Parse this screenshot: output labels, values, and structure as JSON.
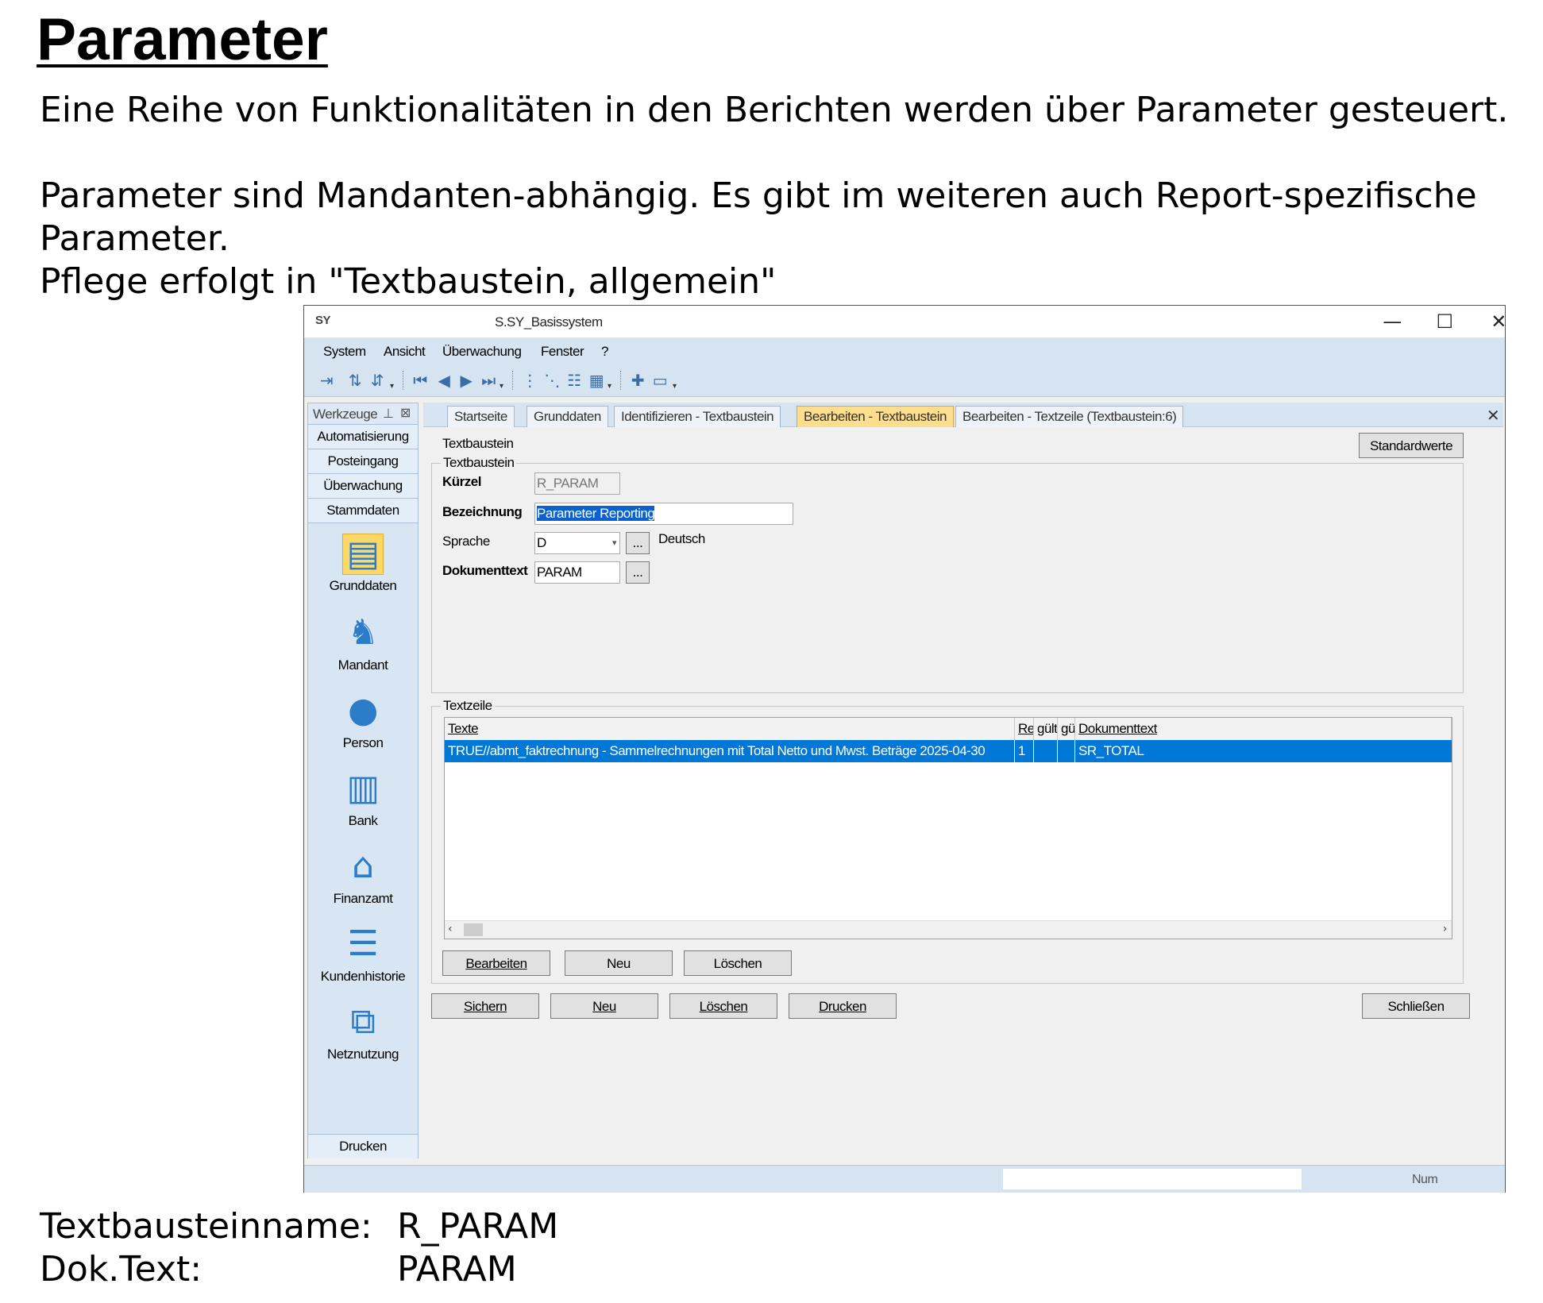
{
  "slide": {
    "title": "Parameter",
    "line1": "Eine Reihe von Funktionalitäten in den Berichten werden über Parameter gesteuert.",
    "line2": "Parameter sind Mandanten-abhängig. Es gibt im weiteren auch Report-spezifische",
    "line3": "Parameter.",
    "line4": "Pflege erfolgt in \"Textbaustein, allgemein\"",
    "footer_label1": "Textbausteinname:",
    "footer_value1": "R_PARAM",
    "footer_label2": "Dok.Text:",
    "footer_value2": "PARAM"
  },
  "window": {
    "logo": "SY",
    "title": "S.SY_Basissystem",
    "minimize": "—",
    "maximize": "☐",
    "close": "✕"
  },
  "menu": [
    "System",
    "Ansicht",
    "Überwachung",
    "Fenster",
    "?"
  ],
  "tools_panel": {
    "title": "Werkzeuge",
    "categories": [
      "Automatisierung",
      "Posteingang",
      "Überwachung",
      "Stammdaten"
    ],
    "items": [
      {
        "label": "Grunddaten",
        "icon": "grunddaten-icon"
      },
      {
        "label": "Mandant",
        "icon": "mandant-icon"
      },
      {
        "label": "Person",
        "icon": "person-icon"
      },
      {
        "label": "Bank",
        "icon": "bank-icon"
      },
      {
        "label": "Finanzamt",
        "icon": "finanzamt-icon"
      },
      {
        "label": "Kundenhistorie",
        "icon": "kundenhistorie-icon"
      },
      {
        "label": "Netznutzung",
        "icon": "netznutzung-icon"
      }
    ],
    "footer": "Drucken"
  },
  "tabs": [
    "Startseite",
    "Grunddaten",
    "Identifizieren - Textbaustein",
    "Bearbeiten - Textbaustein",
    "Bearbeiten - Textzeile (Textbaustein:6)"
  ],
  "active_tab": "Bearbeiten - Textbaustein",
  "form": {
    "heading": "Textbaustein",
    "standardwerte": "Standardwerte",
    "group_title": "Textbaustein",
    "kuerzel_label": "Kürzel",
    "kuerzel_value": "R_PARAM",
    "bezeichnung_label": "Bezeichnung",
    "bezeichnung_value": "Parameter Reporting",
    "sprache_label": "Sprache",
    "sprache_value": "D",
    "sprache_text": "Deutsch",
    "dokumenttext_label": "Dokumenttext",
    "dokumenttext_value": "PARAM",
    "ellipsis": "..."
  },
  "textzeile": {
    "group_title": "Textzeile",
    "columns": [
      "Texte",
      "Re",
      "gült",
      "gü",
      "Dokumenttext"
    ],
    "rows": [
      {
        "texte": "TRUE//abmt_faktrechnung - Sammelrechnungen mit Total Netto und Mwst. Beträge 2025-04-30",
        "re": "1",
        "guelt": "",
        "gue": "",
        "dokumenttext": "SR_TOTAL"
      }
    ],
    "buttons": [
      "Bearbeiten",
      "Neu",
      "Löschen"
    ]
  },
  "bottom_buttons": [
    "Sichern",
    "Neu",
    "Löschen",
    "Drucken"
  ],
  "close_button": "Schließen",
  "status": {
    "num": "Num"
  }
}
